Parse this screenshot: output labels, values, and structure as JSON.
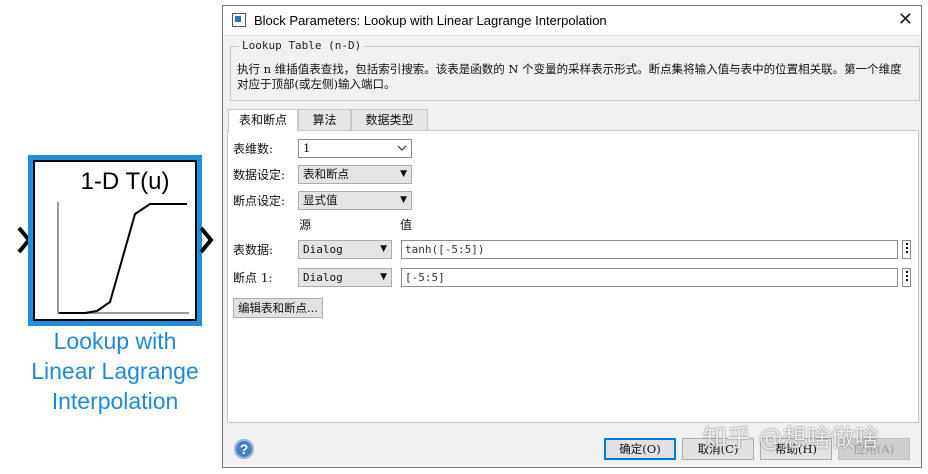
{
  "block": {
    "title": "1-D T(u)",
    "caption": [
      "Lookup with",
      "Linear Lagrange",
      "Interpolation"
    ],
    "selection_color": "#1e90e0",
    "caption_color": "#1e8ad6"
  },
  "dialog": {
    "title": "Block Parameters: Lookup with Linear Lagrange Interpolation",
    "close_icon": "close-icon",
    "group_label": "Lookup Table (n-D)",
    "description": "执行 n 维插值表查找，包括索引搜索。该表是函数的 N 个变量的采样表示形式。断点集将输入值与表中的位置相关联。第一个维度对应于顶部(或左侧)输入端口。",
    "tabs": [
      {
        "label": "表和断点",
        "active": true
      },
      {
        "label": "算法",
        "active": false
      },
      {
        "label": "数据类型",
        "active": false
      }
    ],
    "panel": {
      "dims_label": "表维数:",
      "dims_value": "1",
      "data_spec_label": "数据设定:",
      "data_spec_value": "表和断点",
      "bp_spec_label": "断点设定:",
      "bp_spec_value": "显式值",
      "col_source": "源",
      "col_value": "值",
      "table_label": "表数据:",
      "table_source": "Dialog",
      "table_value": "tanh([-5:5])",
      "bp1_label": "断点 1:",
      "bp1_source": "Dialog",
      "bp1_value": "[-5:5]",
      "edit_button": "编辑表和断点..."
    },
    "buttons": {
      "help_icon": "help-icon",
      "ok": "确定(O)",
      "cancel": "取消(C)",
      "help": "帮助(H)",
      "apply": "应用(A)"
    }
  },
  "watermark": "知乎 @想啥做啥"
}
